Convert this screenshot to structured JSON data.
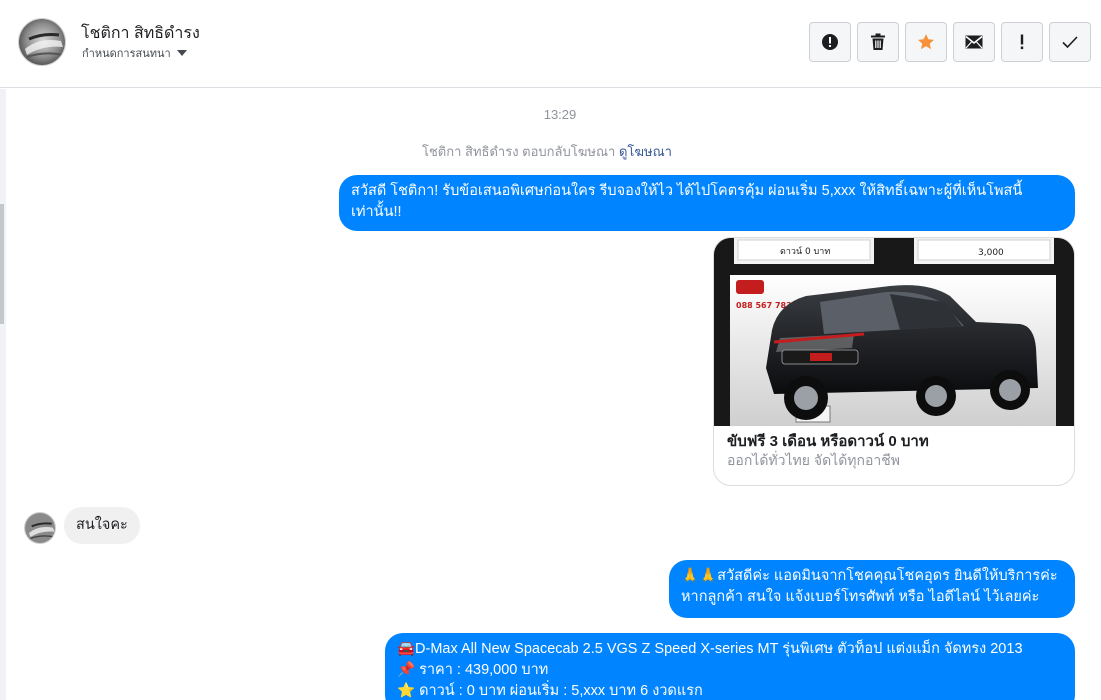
{
  "header": {
    "contact_name": "โชติกา สิทธิดำรง",
    "subtitle": "กำหนดการสนทนา",
    "toolbar": [
      {
        "name": "report-icon",
        "title": "report"
      },
      {
        "name": "trash-icon",
        "title": "delete"
      },
      {
        "name": "star-icon",
        "title": "star"
      },
      {
        "name": "envelope-icon",
        "title": "mark unread"
      },
      {
        "name": "exclamation-icon",
        "title": "important"
      },
      {
        "name": "check-icon",
        "title": "done"
      }
    ],
    "star_color": "#f7923b"
  },
  "thread": {
    "timestamp": "13:29",
    "reply_note": "โชติกา สิทธิดำรง ตอบกลับโฆษณา",
    "reply_link": "ดูโฆษณา",
    "message_1": "สวัสดี โชติกา! รับข้อเสนอพิเศษก่อนใคร รีบจองให้ไว ได้ไปโคตรคุ้ม ผ่อนเริ่ม 5,xxx ให้สิทธิ์เฉพาะผู้ที่เห็นโพสนี้เท่านั้น!!",
    "card": {
      "title": "ขับฟรี 3 เดือน หรือดาวน์ 0 บาท",
      "subtitle": "ออกได้ทั่วไทย จัดได้ทุกอาชีพ",
      "image_text_left": "ดาวน์ 0 บาท",
      "image_text_right": "3,000",
      "image_phone": "088 567 7832"
    },
    "incoming_message": "สนใจคะ",
    "message_2": "🙏🙏สวัสดีค่ะ แอดมินจากโชคคุณโชคอุดร ยินดีให้บริการค่ะ หากลูกค้า สนใจ แจ้งเบอร์โทรศัพท์ หรือ ไอดีไลน์ ไว้เลยค่ะ",
    "message_3_line_1": "🚘D-Max All New Spacecab 2.5 VGS Z Speed X-series MT รุ่นพิเศษ ตัวท็อป แต่งแม็ก จัดทรง 2013",
    "message_3_line_2": "📌 ราคา : 439,000 บาท",
    "message_3_line_3": "⭐ ดาวน์ : 0 บาท ผ่อนเริ่ม : 5,xxx บาท 6 งวดแรก"
  },
  "colors": {
    "outgoing_bubble": "#0084ff",
    "incoming_bubble": "#f1f0f0",
    "link": "#385898"
  }
}
